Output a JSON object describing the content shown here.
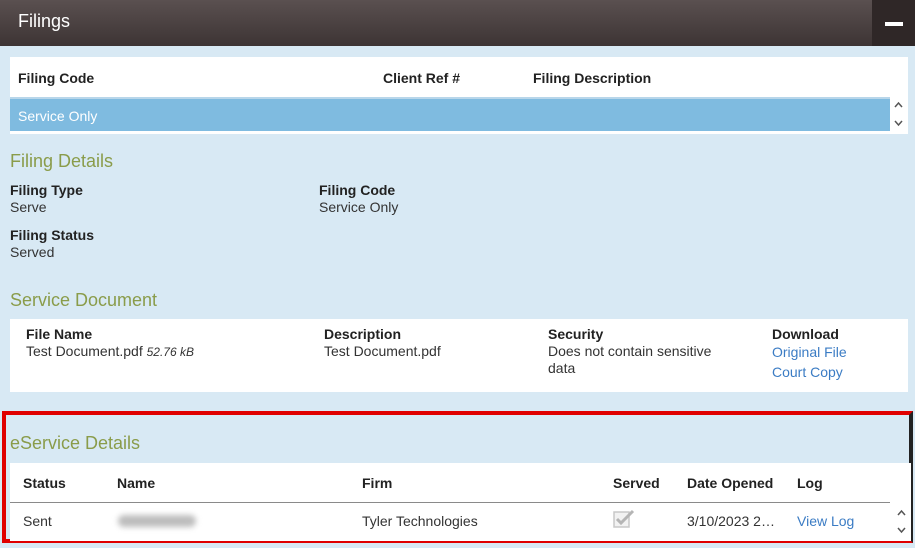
{
  "header": {
    "title": "Filings"
  },
  "filings_table": {
    "columns": [
      "Filing Code",
      "Client Ref #",
      "Filing Description"
    ],
    "rows": [
      {
        "filing_code": "Service Only"
      }
    ]
  },
  "filing_details": {
    "title": "Filing Details",
    "filing_type_label": "Filing Type",
    "filing_type_value": "Serve",
    "filing_code_label": "Filing Code",
    "filing_code_value": "Service Only",
    "filing_status_label": "Filing Status",
    "filing_status_value": "Served"
  },
  "service_document": {
    "title": "Service Document",
    "columns": [
      "File Name",
      "Description",
      "Security",
      "Download"
    ],
    "file_name": "Test Document.pdf",
    "file_size": "52.76 kB",
    "description": "Test Document.pdf",
    "security_line1": "Does not contain sensitive",
    "security_line2": "data",
    "download_links": [
      "Original File",
      "Court Copy"
    ]
  },
  "eservice": {
    "title": "eService Details",
    "columns": [
      "Status",
      "Name",
      "Firm",
      "Served",
      "Date Opened",
      "Log"
    ],
    "row": {
      "status": "Sent",
      "firm": "Tyler Technologies",
      "served": true,
      "date_opened": "3/10/2023 2…",
      "log": "View Log"
    }
  },
  "colors": {
    "header": "#3d3434",
    "panel": "#d8e9f4",
    "selected_row": "#7fbbe0",
    "section_title": "#8a9c4a",
    "link": "#3b7cc4",
    "highlight_border": "#e00000"
  }
}
